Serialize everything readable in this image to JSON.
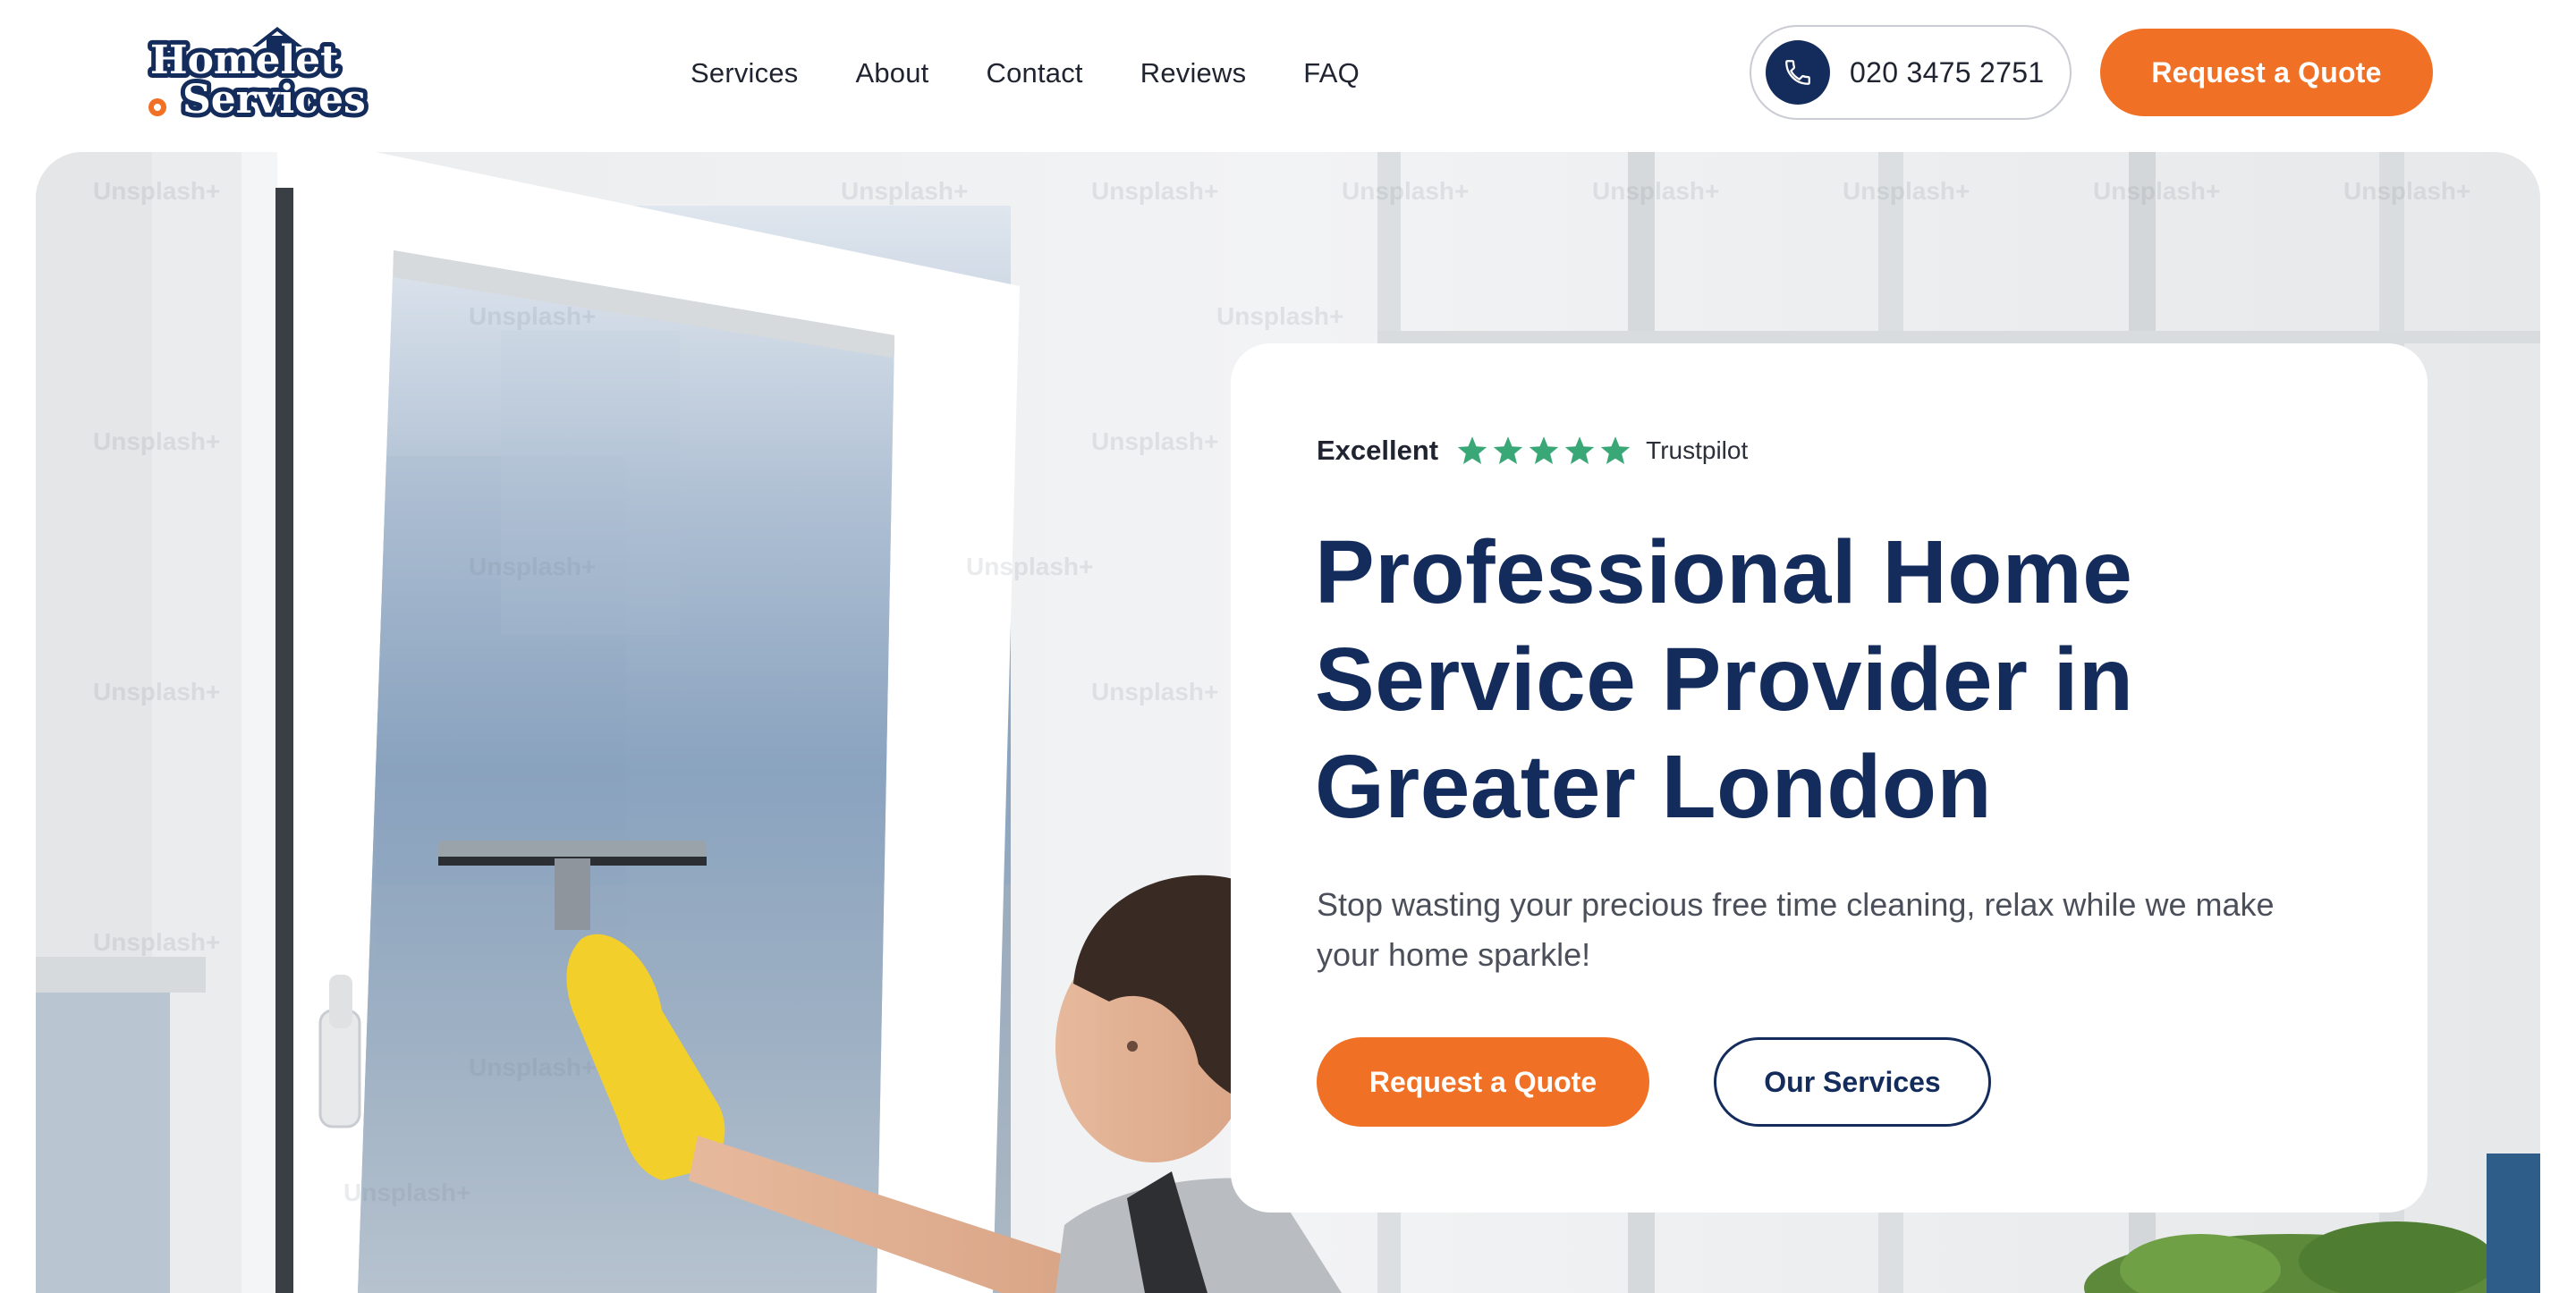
{
  "brand": {
    "logo_line1": "Homelet",
    "logo_line2": "Services",
    "navy": "#142c5c",
    "orange": "#f07125",
    "trust_green": "#3aa876"
  },
  "nav": {
    "items": [
      {
        "label": "Services"
      },
      {
        "label": "About"
      },
      {
        "label": "Contact"
      },
      {
        "label": "Reviews"
      },
      {
        "label": "FAQ"
      }
    ]
  },
  "header": {
    "phone_icon": "phone-icon",
    "phone_number": "020 3475 2751",
    "cta_label": "Request a Quote"
  },
  "hero": {
    "watermark_text": "Unsplash+",
    "rating": {
      "label": "Excellent",
      "stars": 5,
      "provider": "Trustpilot"
    },
    "headline": "Professional Home Service Provider in Greater London",
    "subtext": "Stop wasting your precious free time cleaning, relax while we make your home sparkle!",
    "primary_cta": "Request a Quote",
    "secondary_cta": "Our Services"
  }
}
